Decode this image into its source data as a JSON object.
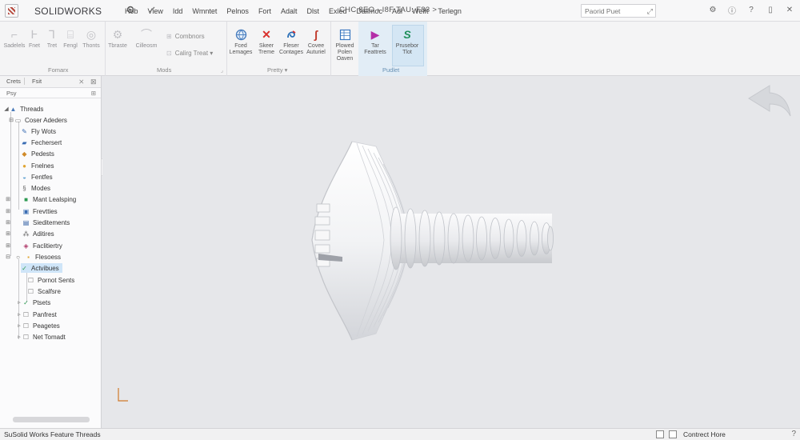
{
  "app": {
    "name": "SOLIDWORKS"
  },
  "menu": [
    "Hob",
    "View",
    "Idd",
    "Wmntet",
    "Pelnos",
    "Fort",
    "Adalt",
    "Dlst",
    "Exled",
    "Dallmoc",
    "Adl",
    "Weift",
    "Terlegn"
  ],
  "document_title": "CHC 8EO  ›  I8F TAU: F83 >",
  "search": {
    "placeholder": "Paorid Puet"
  },
  "ribbon": {
    "left_tools": [
      "Sadelels",
      "Fnet",
      "Tret",
      "Fengl",
      "Thonts"
    ],
    "threads": {
      "label": "Tbraste",
      "group": "Fomarx"
    },
    "cosmetic_label": "Cilleosm",
    "small_buttons": [
      "Combnors",
      "Calirg Treat"
    ],
    "mods_group": "Mods",
    "fix_tools": [
      "Fced Lemages",
      "Skeer Treme",
      "Fleser Contages",
      "Covee Auturiel"
    ],
    "pretty_group": "Pretty",
    "publish_tools": [
      "Plowed Polen Oaven",
      "Tar Feattrets",
      "Prusebor Tlot"
    ],
    "publish_group": "Pudlet"
  },
  "panel": {
    "tab1": "Crets",
    "tab2": "Fsit",
    "filter": "Psy",
    "tree": [
      {
        "label": "Threads"
      },
      {
        "label": "Coser Adeders"
      },
      {
        "label": "Fly Wots"
      },
      {
        "label": "Fechersert"
      },
      {
        "label": "Pedests"
      },
      {
        "label": "Fnelnes"
      },
      {
        "label": "Fentfes"
      },
      {
        "label": "Modes"
      },
      {
        "label": "Mant Lealsping"
      },
      {
        "label": "Frevtties"
      },
      {
        "label": "Sieditements"
      },
      {
        "label": "Aditires"
      },
      {
        "label": "Faclitiertry"
      },
      {
        "label": "Flesoess"
      },
      {
        "label": "Actvibues"
      },
      {
        "label": "Pornot Sents"
      },
      {
        "label": "Scalfsre"
      },
      {
        "label": "Ptsets"
      },
      {
        "label": "Panfrest"
      },
      {
        "label": "Peagetes"
      },
      {
        "label": "Net Tomadt"
      }
    ]
  },
  "status": {
    "left": "SuSolid Works Feature Threads",
    "right": "Contrect Hore"
  },
  "colors": {
    "accent": "#6690b4",
    "selection": "#cfe5f8",
    "red": "#d9302c",
    "green": "#1f8f5a",
    "purple": "#b42ea8"
  }
}
